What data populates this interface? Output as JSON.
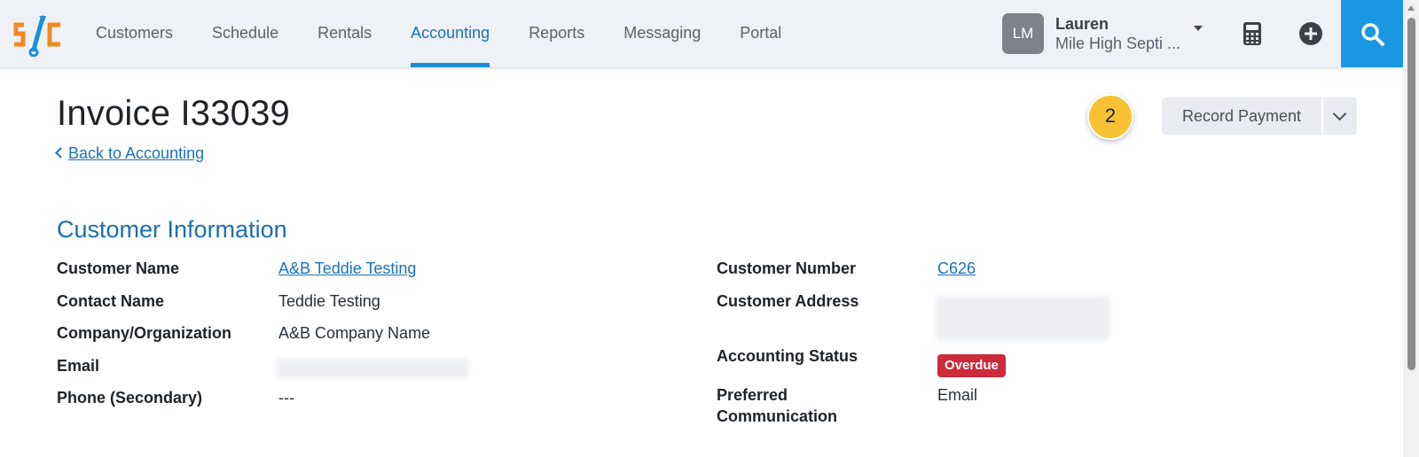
{
  "app": {
    "logo_text": "s/c",
    "colors": {
      "accent": "#1a73b8",
      "search_bg": "#1a97e2",
      "logo_orange": "#f28a1e",
      "logo_blue": "#1a8fd8",
      "overdue": "#cc2b3c",
      "step_badge": "#f7c236"
    }
  },
  "nav": {
    "items": [
      {
        "label": "Customers",
        "active": false
      },
      {
        "label": "Schedule",
        "active": false
      },
      {
        "label": "Rentals",
        "active": false
      },
      {
        "label": "Accounting",
        "active": true
      },
      {
        "label": "Reports",
        "active": false
      },
      {
        "label": "Messaging",
        "active": false
      },
      {
        "label": "Portal",
        "active": false
      }
    ]
  },
  "user": {
    "initials": "LM",
    "name": "Lauren",
    "org": "Mile High Septi ..."
  },
  "header_icons": {
    "calculator": "calculator-icon",
    "add": "plus-circle-icon",
    "search": "search-icon"
  },
  "page": {
    "title": "Invoice I33039",
    "back_link": "Back to Accounting",
    "step_badge": "2",
    "record_payment": "Record Payment"
  },
  "customer_info": {
    "heading": "Customer Information",
    "left": [
      {
        "label": "Customer Name",
        "value": "A&B Teddie Testing"
      },
      {
        "label": "Contact Name",
        "value": "Teddie Testing"
      },
      {
        "label": "Company/Organization",
        "value": "A&B Company Name"
      },
      {
        "label": "Email",
        "value": ""
      },
      {
        "label": "Phone (Secondary)",
        "value": "---"
      }
    ],
    "right": [
      {
        "label": "Customer Number",
        "value": "C626"
      },
      {
        "label": "Customer Address",
        "value": ""
      },
      {
        "label": "Accounting Status",
        "value": "Overdue"
      },
      {
        "label": "Preferred",
        "label2": "Communication",
        "value": "Email"
      }
    ]
  }
}
